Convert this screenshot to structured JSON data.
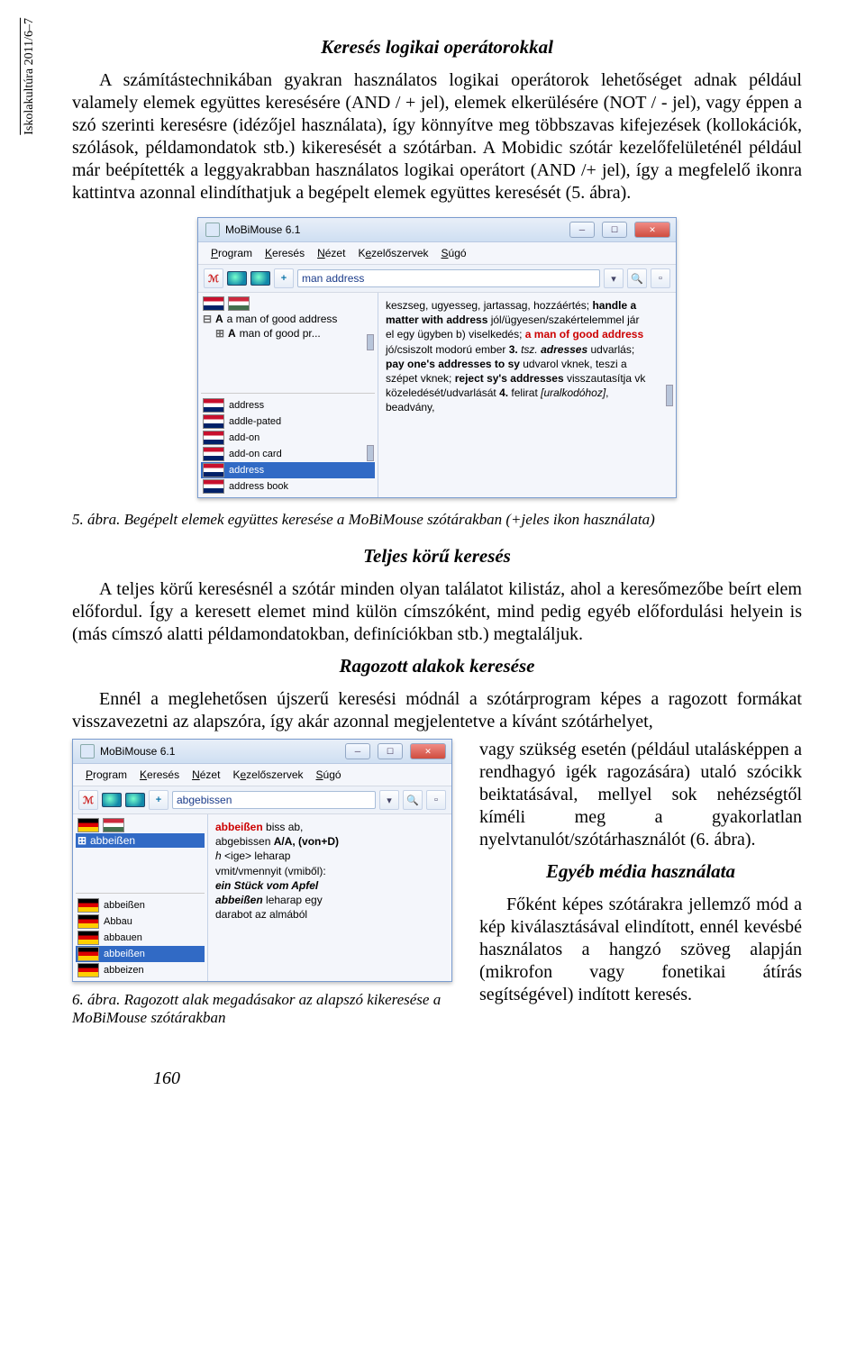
{
  "journal": "Iskolakultúra 2011/6–7",
  "h1": "Keresés logikai operátorokkal",
  "p1": "A számítástechnikában gyakran használatos logikai operátorok lehetőséget adnak például valamely elemek együttes keresésére (AND / + jel), elemek elkerülésére (NOT / - jel), vagy éppen a szó szerinti keresésre (idézőjel használata), így könnyítve meg többszavas kifejezések (kollokációk, szólások, példamondatok stb.) kikeresését a szótárban. A Mobidic szótár kezelőfelületénél például már beépítették a leggyakrabban használatos logikai operátort (AND /+ jel), így a megfelelő ikonra kattintva azonnal elindíthatjuk a begépelt elemek együttes keresését (5. ábra).",
  "cap1": "5. ábra. Begépelt elemek együttes keresése a MoBiMouse szótárakban (+jeles ikon használata)",
  "h2": "Teljes körű keresés",
  "p2": "A teljes körű keresésnél a szótár minden olyan találatot kilistáz, ahol a keresőmezőbe beírt elem előfordul. Így a keresett elemet mind külön címszóként, mind pedig egyéb előfordulási helyein is (más címszó alatti példamondatokban, definíciókban stb.) megtaláljuk.",
  "h3": "Ragozott alakok keresése",
  "p3": "Ennél a meglehetősen újszerű keresési módnál a szótárprogram képes a ragozott formákat visszavezetni az alapszóra, így akár azonnal megjelentetve a kívánt szótárhelyet,",
  "p3b": "vagy szükség esetén (például utalásképpen a rendhagyó igék ragozására) utaló szócikk beiktatásával, mellyel sok nehézségtől kíméli meg a gyakorlatlan nyelvtanulót/szótárhasználót (6. ábra).",
  "h4": "Egyéb média használata",
  "p4": "Főként képes szótárakra jellemző mód a kép kiválasztásával elindított, ennél kevésbé használatos a hangzó szöveg alapján (mikrofon vagy fonetikai átírás segítségével) indított keresés.",
  "cap2": "6. ábra. Ragozott alak megadásakor az alapszó kikeresése a MoBiMouse szótárakban",
  "page": "160",
  "win1": {
    "title": "MoBiMouse 6.1",
    "menu": [
      "Program",
      "Keresés",
      "Nézet",
      "Kezelőszervek",
      "Súgó"
    ],
    "search": "man address",
    "left_top": [
      "a man of good address",
      "man of good pr..."
    ],
    "left_bottom": [
      "address",
      "addle-pated",
      "add-on",
      "add-on card",
      "address",
      "address book"
    ],
    "right_html": "keszseg, ugyesseg, jartassag, hozzáértés; <span class='bold'>handle a matter with address</span> jól/ügyesen/szakértelemmel jár el egy ügyben b) viselkedés; <span class='red'>a man of good address</span> jó/csiszolt modorú ember <span class='bold'>3.</span> <span class='ital'>tsz.</span> <span class='bold ital'>adresses</span> udvarlás; <span class='bold'>pay one's addresses to sy</span> udvarol vknek, teszi a szépet vknek; <span class='bold'>reject sy's addresses</span> visszautasítja vk közeledését/udvarlását <span class='bold'>4.</span> felirat <span class='ital'>[uralkodóhoz]</span>, beadvány,"
  },
  "win2": {
    "title": "MoBiMouse 6.1",
    "menu": [
      "Program",
      "Keresés",
      "Nézet",
      "Kezelőszervek",
      "Súgó"
    ],
    "search": "abgebissen",
    "left_top": [
      "abbeißen"
    ],
    "left_bottom": [
      "abbeißen",
      "Abbau",
      "abbauen",
      "abbeißen",
      "abbeizen"
    ],
    "right_html": "<span class='red'>abbeißen</span> biss ab,<br>abgebissen <span class='bold'>A/A, (von+D)</span><br><span class='ital'>h</span> &lt;ige&gt; leharap<br>vmit/vmennyit (vmiből):<br><span class='bold ital'>ein Stück vom Apfel</span><br><span class='bold ital'>abbeißen</span> leharap egy<br>darabot az almából"
  }
}
